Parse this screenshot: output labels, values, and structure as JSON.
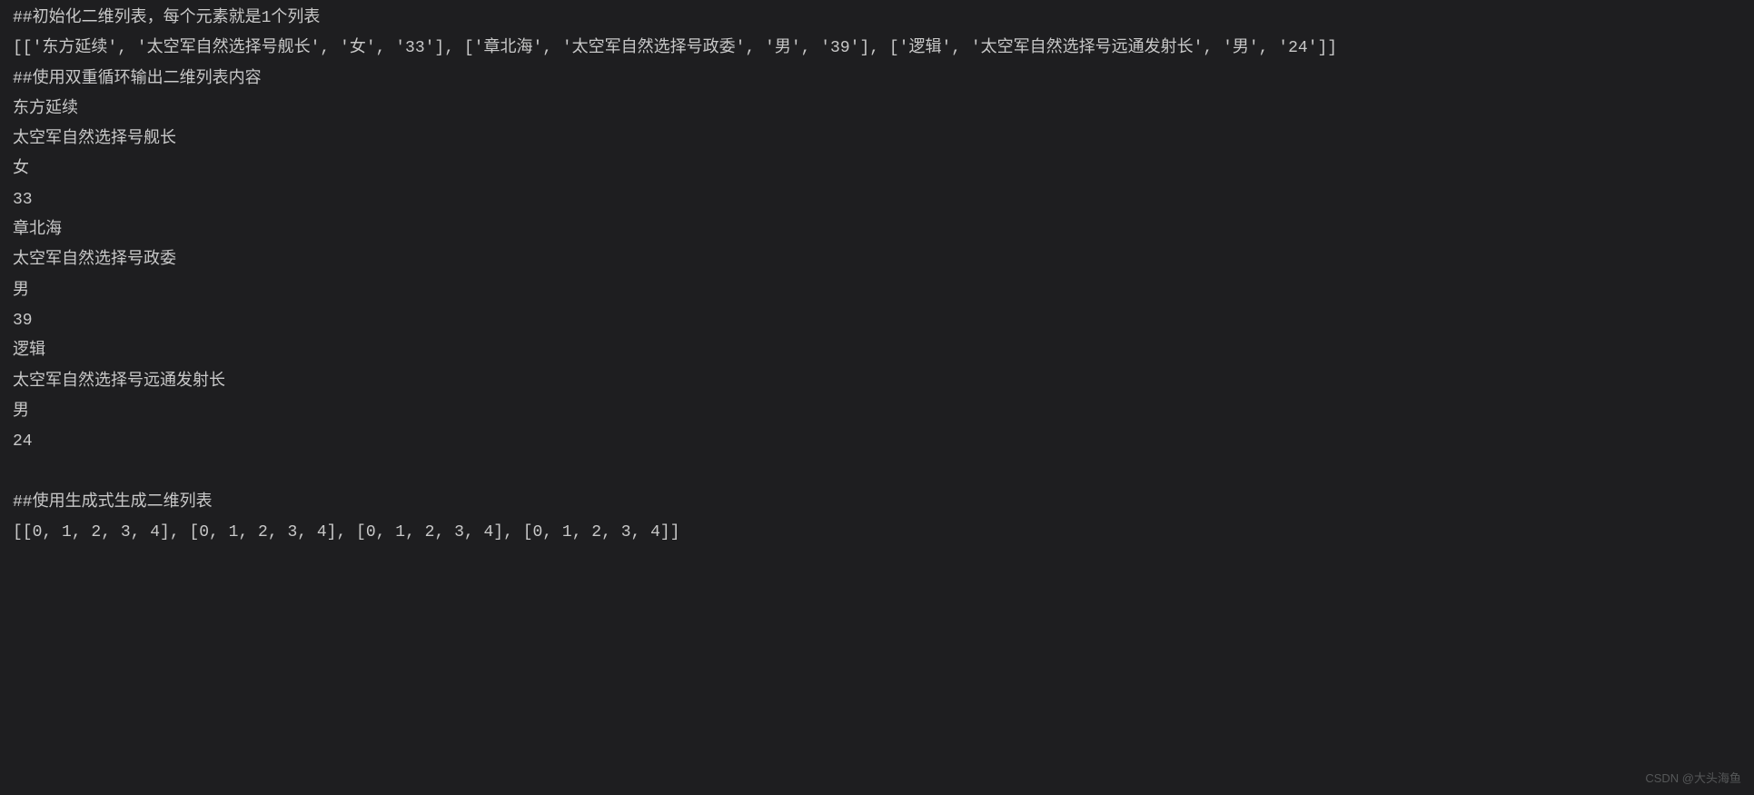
{
  "lines": [
    "##初始化二维列表，每个元素就是1个列表",
    "[['东方延续', '太空军自然选择号舰长', '女', '33'], ['章北海', '太空军自然选择号政委', '男', '39'], ['逻辑', '太空军自然选择号远通发射长', '男', '24']]",
    "##使用双重循环输出二维列表内容",
    "东方延续",
    "太空军自然选择号舰长",
    "女",
    "33",
    "章北海",
    "太空军自然选择号政委",
    "男",
    "39",
    "逻辑",
    "太空军自然选择号远通发射长",
    "男",
    "24",
    "",
    "##使用生成式生成二维列表",
    "[[0, 1, 2, 3, 4], [0, 1, 2, 3, 4], [0, 1, 2, 3, 4], [0, 1, 2, 3, 4]]"
  ],
  "watermark": "CSDN @大头海鱼"
}
